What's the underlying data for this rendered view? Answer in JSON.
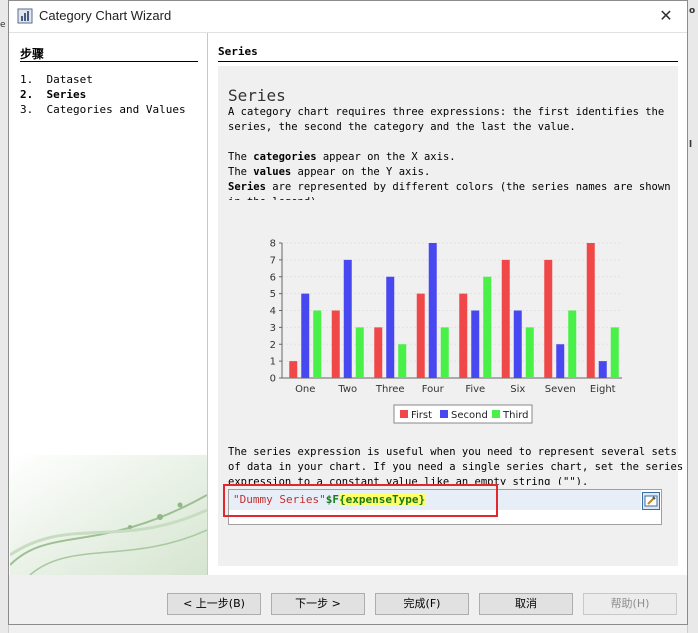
{
  "window": {
    "title": "Category Chart Wizard"
  },
  "steps": {
    "title": "步骤",
    "items": [
      {
        "num": "1.",
        "label": "Dataset"
      },
      {
        "num": "2.",
        "label": "Series"
      },
      {
        "num": "3.",
        "label": "Categories and Values"
      }
    ]
  },
  "content": {
    "section_title": "Series",
    "heading": "Series",
    "intro_1": "A category chart requires three expressions: the first identifies the",
    "intro_2": "series, the second the category and the last the value.",
    "cat_bold": "categories",
    "cat_pre": "The ",
    "cat_post": " appear on the X axis.",
    "val_pre": "The ",
    "val_bold": "values",
    "val_post": " appear on the Y axis.",
    "ser_bold": "Series",
    "ser_post": " are represented by different colors (the series names are shown",
    "ser_clip": "in the legend).",
    "note_1": "The series expression is useful when you need to represent several sets",
    "note_2": "of data in your chart. If you need a single series chart, set the series",
    "note_3": "expression to a constant value like an empty string (\"\").",
    "expression": {
      "string_part": "\"Dummy Series\"",
      "param_prefix": "$F",
      "param_body": "{expenseType}"
    }
  },
  "chart_data": {
    "type": "bar",
    "categories": [
      "One",
      "Two",
      "Three",
      "Four",
      "Five",
      "Six",
      "Seven",
      "Eight"
    ],
    "series": [
      {
        "name": "First",
        "color": "#f04848",
        "values": [
          1,
          4,
          3,
          5,
          5,
          7,
          7,
          8
        ]
      },
      {
        "name": "Second",
        "color": "#4848f0",
        "values": [
          5,
          7,
          6,
          8,
          4,
          4,
          2,
          1
        ]
      },
      {
        "name": "Third",
        "color": "#48f048",
        "values": [
          4,
          3,
          2,
          3,
          6,
          3,
          4,
          3
        ]
      }
    ],
    "ylim": [
      0,
      8
    ],
    "yticks": [
      "0",
      "1",
      "2",
      "3",
      "4",
      "5",
      "6",
      "7",
      "8"
    ],
    "grid": true,
    "legend": "bottom"
  },
  "buttons": {
    "back": "< 上一步(B)",
    "next": "下一步 >",
    "finish": "完成(F)",
    "cancel": "取消",
    "help": "帮助(H)"
  }
}
